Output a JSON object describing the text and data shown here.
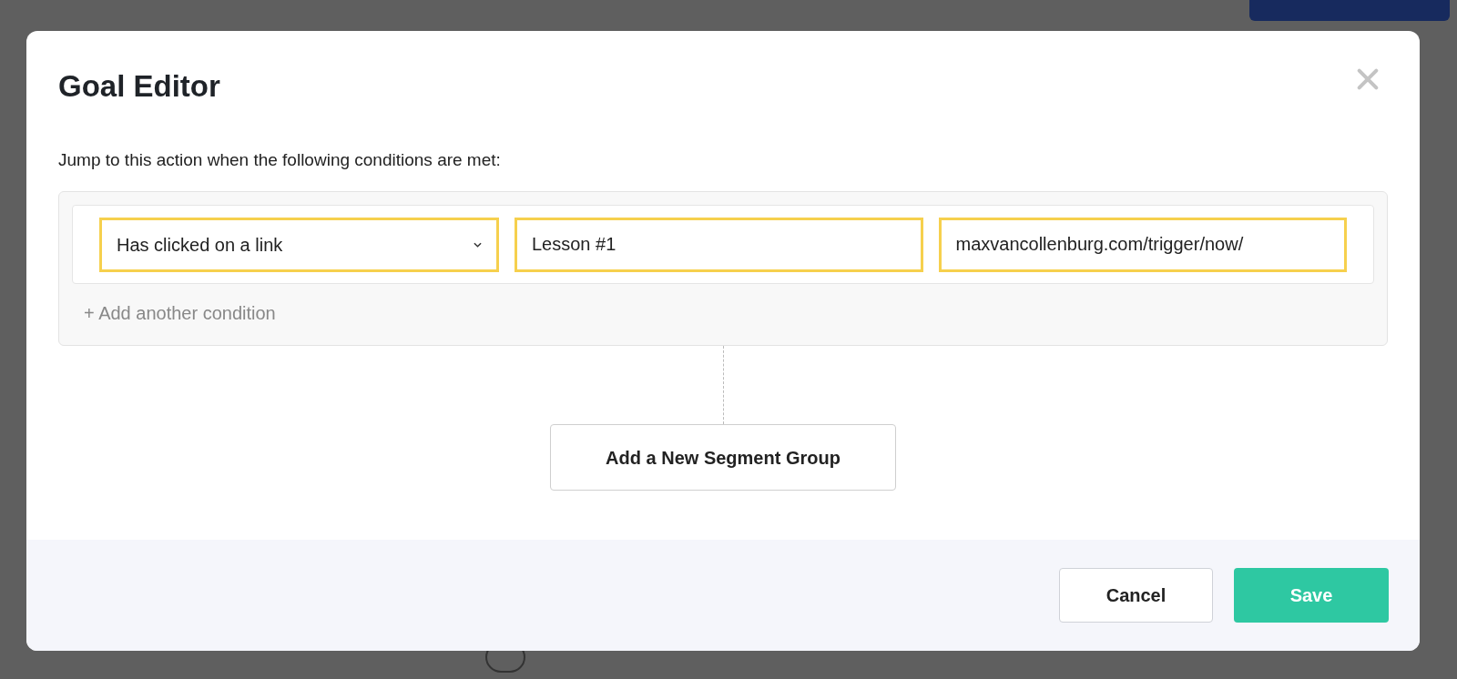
{
  "dialog": {
    "title": "Goal Editor",
    "instruction": "Jump to this action when the following conditions are met:",
    "conditions": [
      {
        "kind": "select",
        "value": "Has clicked on a link",
        "highlighted": true
      },
      {
        "kind": "text",
        "value": "Lesson #1",
        "highlighted": true
      },
      {
        "kind": "text",
        "value": "maxvancollenburg.com/trigger/now/",
        "highlighted": true
      }
    ],
    "add_condition": "+ Add another condition",
    "add_segment_group": "Add a New Segment Group",
    "buttons": [
      {
        "kind": "secondary",
        "label": "Cancel"
      },
      {
        "kind": "primary",
        "label": "Save"
      }
    ]
  }
}
